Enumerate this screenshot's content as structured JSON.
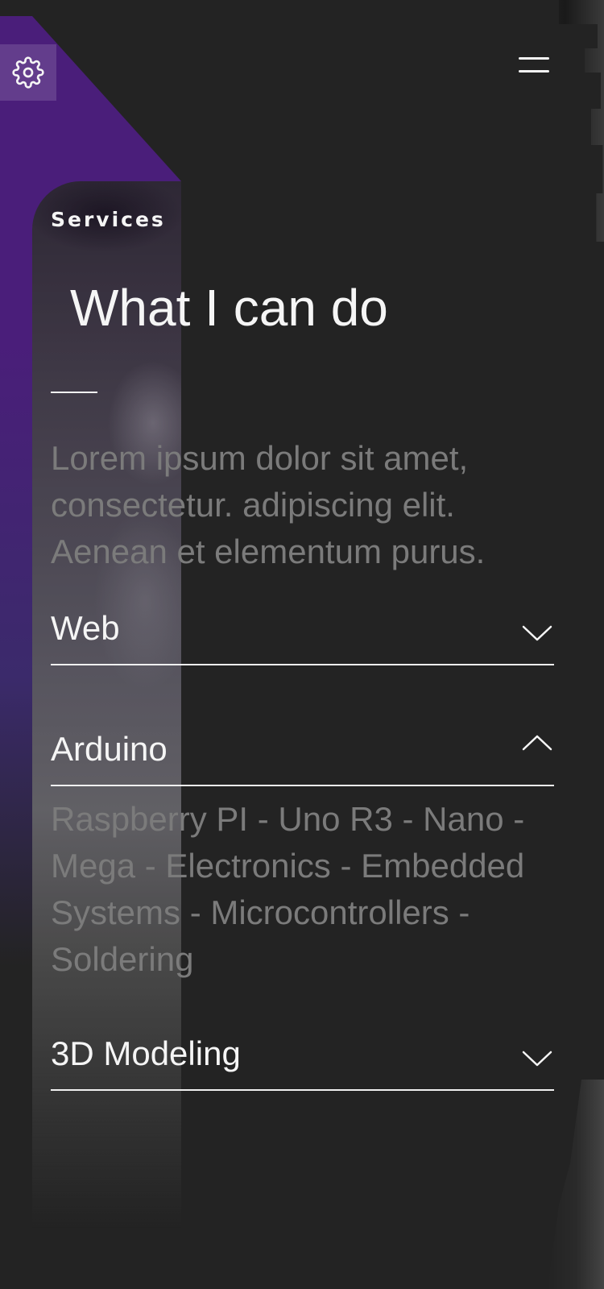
{
  "header": {
    "settings_icon": "gear-icon",
    "menu_icon": "hamburger-menu-icon"
  },
  "section": {
    "eyebrow": "Services",
    "title": "What I can do",
    "intro": "Lorem ipsum dolor sit amet, consectetur. adipiscing elit. Aenean et elementum purus."
  },
  "accordion": {
    "items": [
      {
        "label": "Web",
        "expanded": false,
        "icon": "chevron-down-icon"
      },
      {
        "label": "Arduino",
        "expanded": true,
        "icon": "chevron-up-icon",
        "body": "Raspberry PI - Uno R3 - Nano - Mega - Electronics - Embedded Systems - Microcontrollers - Soldering"
      },
      {
        "label": "3D Modeling",
        "expanded": false,
        "icon": "chevron-down-icon"
      }
    ]
  },
  "colors": {
    "background": "#232323",
    "accent": "#4a1e7a",
    "text": "#f5f5f5",
    "muted_text": "#7b7b7b"
  }
}
